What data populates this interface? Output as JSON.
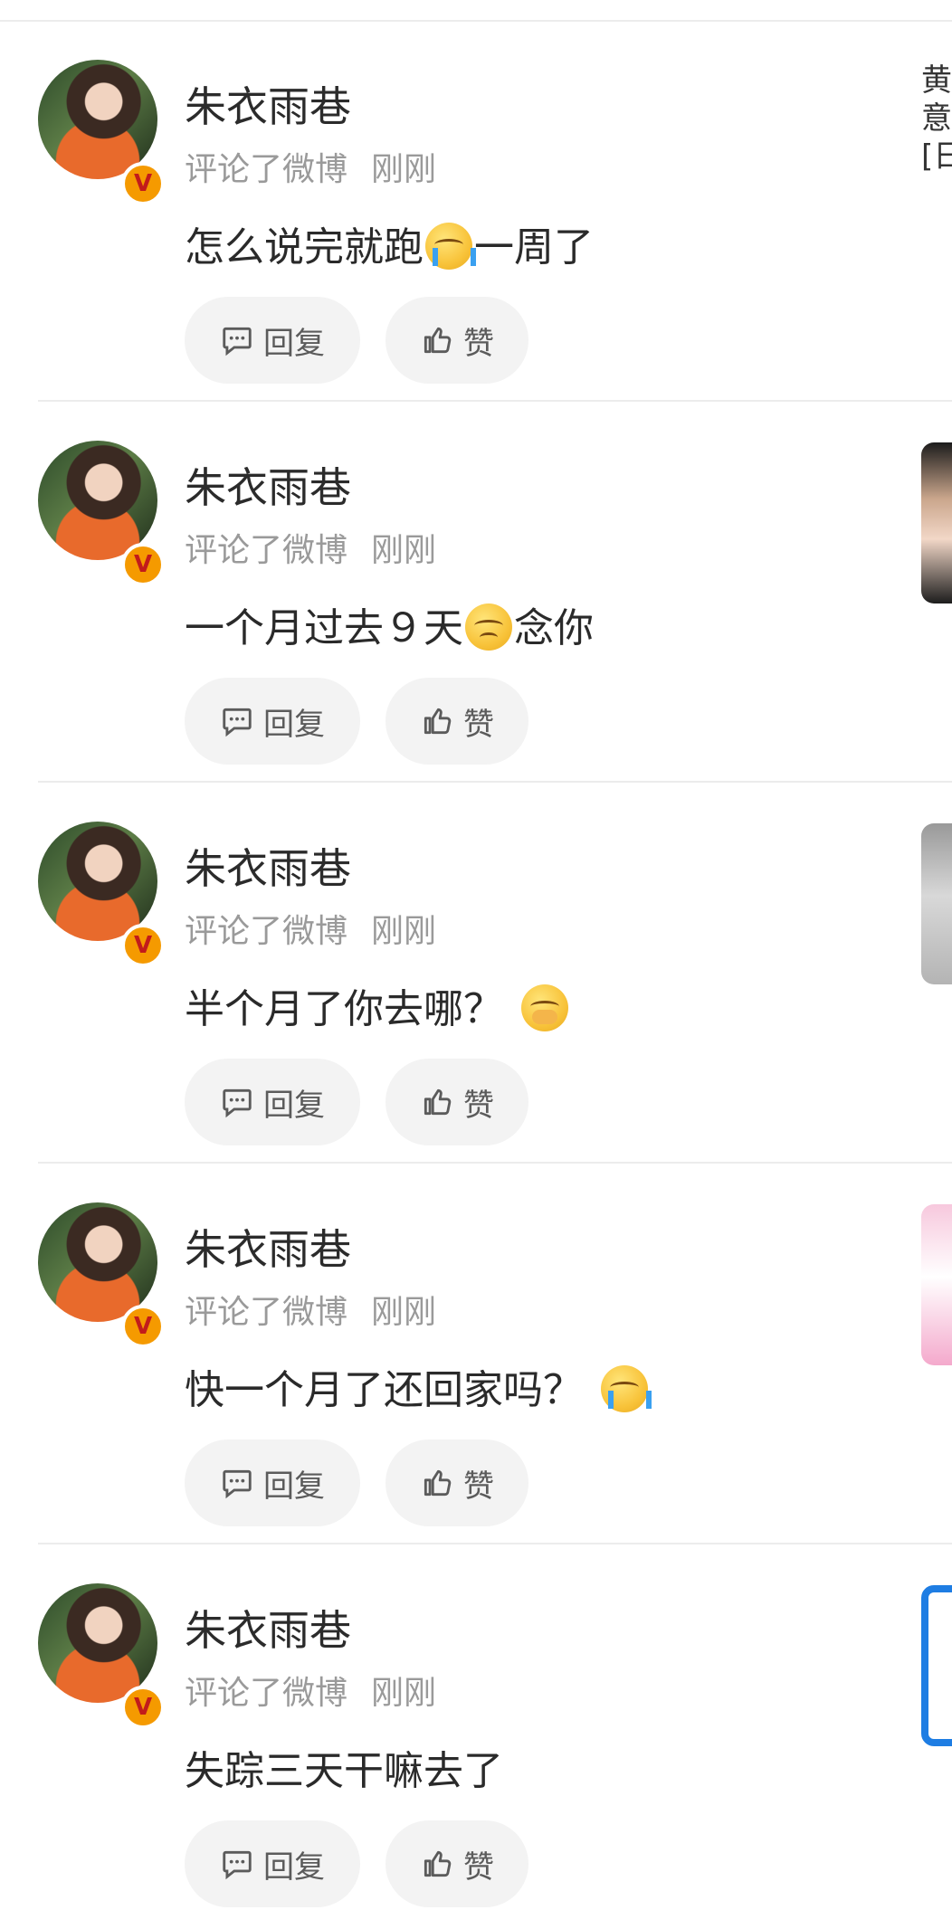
{
  "items": [
    {
      "name": "朱衣雨巷",
      "action": "评论了微博",
      "time": "刚刚",
      "text_before": "怎么说完就跑",
      "text_after": "一周了",
      "reply": "回复",
      "like": "赞",
      "preview_text": [
        "黄",
        "意",
        "[日"
      ]
    },
    {
      "name": "朱衣雨巷",
      "action": "评论了微博",
      "time": "刚刚",
      "text_before": "一个月过去９天",
      "text_after": "念你",
      "reply": "回复",
      "like": "赞"
    },
    {
      "name": "朱衣雨巷",
      "action": "评论了微博",
      "time": "刚刚",
      "text_before": "半个月了你去哪？",
      "text_after": "",
      "reply": "回复",
      "like": "赞"
    },
    {
      "name": "朱衣雨巷",
      "action": "评论了微博",
      "time": "刚刚",
      "text_before": "快一个月了还回家吗？",
      "text_after": "",
      "reply": "回复",
      "like": "赞"
    },
    {
      "name": "朱衣雨巷",
      "action": "评论了微博",
      "time": "刚刚",
      "text_before": "失踪三天干嘛去了",
      "text_after": "",
      "reply": "回复",
      "like": "赞"
    }
  ],
  "icons": {
    "reply": "comment-bubble-icon",
    "like": "thumbs-up-icon",
    "verified": "verified-v-badge-icon"
  },
  "colors": {
    "badge": "#f59a00",
    "meta": "#9a9a9a",
    "button_bg": "#f3f3f3"
  }
}
